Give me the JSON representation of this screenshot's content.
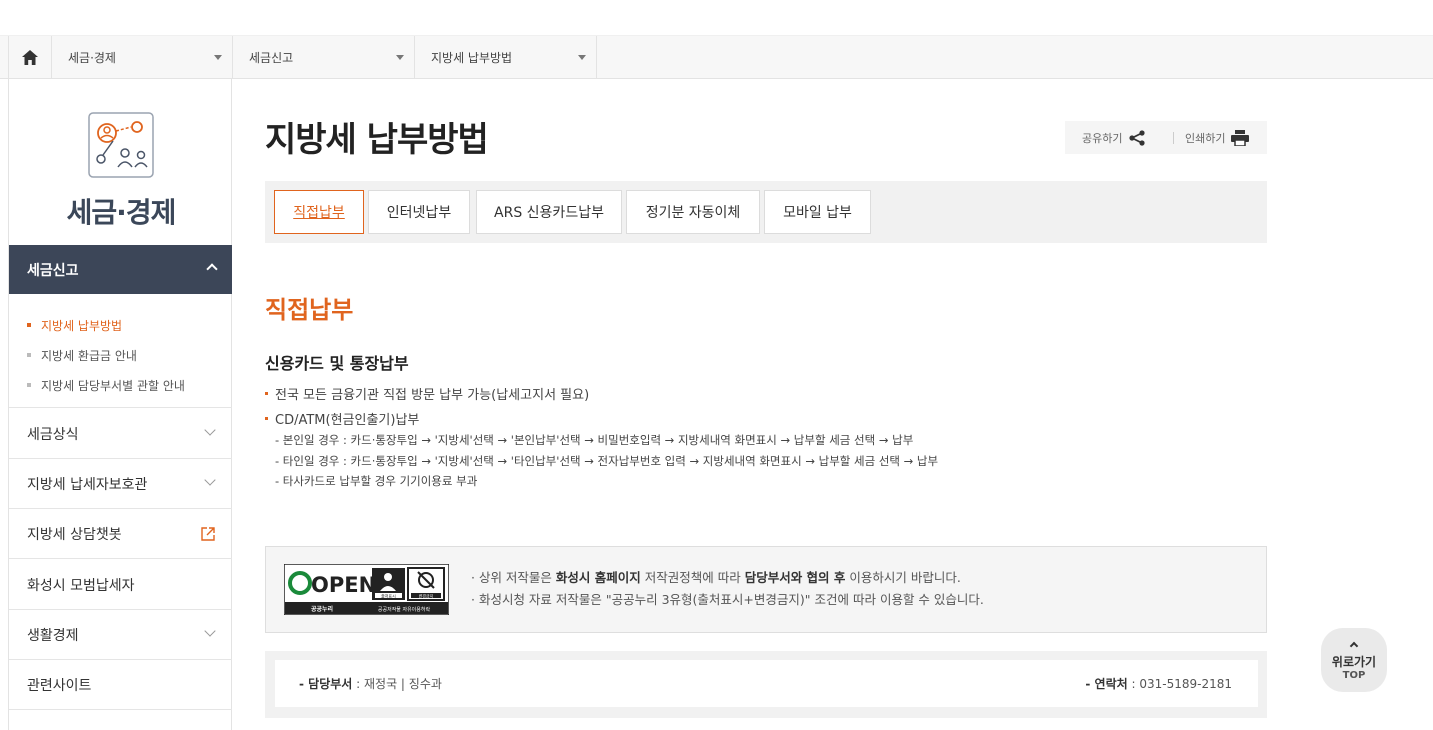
{
  "breadcrumb": {
    "home_icon": "home-icon",
    "items": [
      {
        "label": "세금·경제"
      },
      {
        "label": "세금신고"
      },
      {
        "label": "지방세 납부방법"
      }
    ]
  },
  "sidebar": {
    "icon": "people-network-icon",
    "title": "세금·경제",
    "active_menu": "세금신고",
    "sub_items": [
      {
        "label": "지방세 납부방법"
      },
      {
        "label": "지방세 환급금 안내"
      },
      {
        "label": "지방세 담당부서별 관할 안내"
      }
    ],
    "menus": [
      {
        "label": "세금상식"
      },
      {
        "label": "지방세 납세자보호관"
      },
      {
        "label": "지방세 상담챗봇"
      },
      {
        "label": "화성시 모범납세자"
      },
      {
        "label": "생활경제"
      },
      {
        "label": "관련사이트"
      }
    ]
  },
  "page": {
    "title": "지방세 납부방법",
    "share_label": "공유하기",
    "print_label": "인쇄하기"
  },
  "tabs": [
    {
      "label": "직접납부"
    },
    {
      "label": "인터넷납부"
    },
    {
      "label": "ARS 신용카드납부"
    },
    {
      "label": "정기분 자동이체"
    },
    {
      "label": "모바일 납부"
    }
  ],
  "content": {
    "section_title": "직접납부",
    "sub_title": "신용카드 및 통장납부",
    "bullets": [
      "전국 모든 금융기관 직접 방문 납부 가능(납세고지서 필요)",
      "CD/ATM(현금인출기)납부"
    ],
    "details": [
      "- 본인일 경우 : 카드·통장투입 → '지방세'선택 → '본인납부'선택 → 비밀번호입력 → 지방세내역 화면표시 → 납부할 세금 선택 → 납부",
      "- 타인일 경우 : 카드·통장투입 → '지방세'선택 → '타인납부'선택 → 전자납부번호 입력 → 지방세내역 화면표시 → 납부할 세금 선택 → 납부",
      "- 타사카드로 납부할 경우 기기이용료 부과"
    ]
  },
  "open_license": {
    "logo_text": "OPEN",
    "logo_sub_left": "공공누리",
    "logo_sub_right": "공공저작물 자유이용허락",
    "badge1": "출처표시",
    "badge2": "변경금지",
    "line1_a": "· 상위 저작물은 ",
    "line1_b": "화성시 홈페이지",
    "line1_c": " 저작권정책에 따라 ",
    "line1_d": "담당부서와 협의 후",
    "line1_e": " 이용하시기 바랍니다.",
    "line2": "· 화성시청 자료 저작물은 \"공공누리 3유형(출처표시+변경금지)\" 조건에 따라 이용할 수 있습니다."
  },
  "contact": {
    "dept_label": "- 담당부서",
    "dept_value": " : 재정국 | 징수과",
    "tel_label": "- 연락처",
    "tel_value": " : 031-5189-2181"
  },
  "top_button": {
    "label": "위로가기",
    "sub": "TOP"
  },
  "colors": {
    "accent": "#e0641e",
    "sidebar_active": "#3c4658",
    "title": "#3b4759"
  }
}
